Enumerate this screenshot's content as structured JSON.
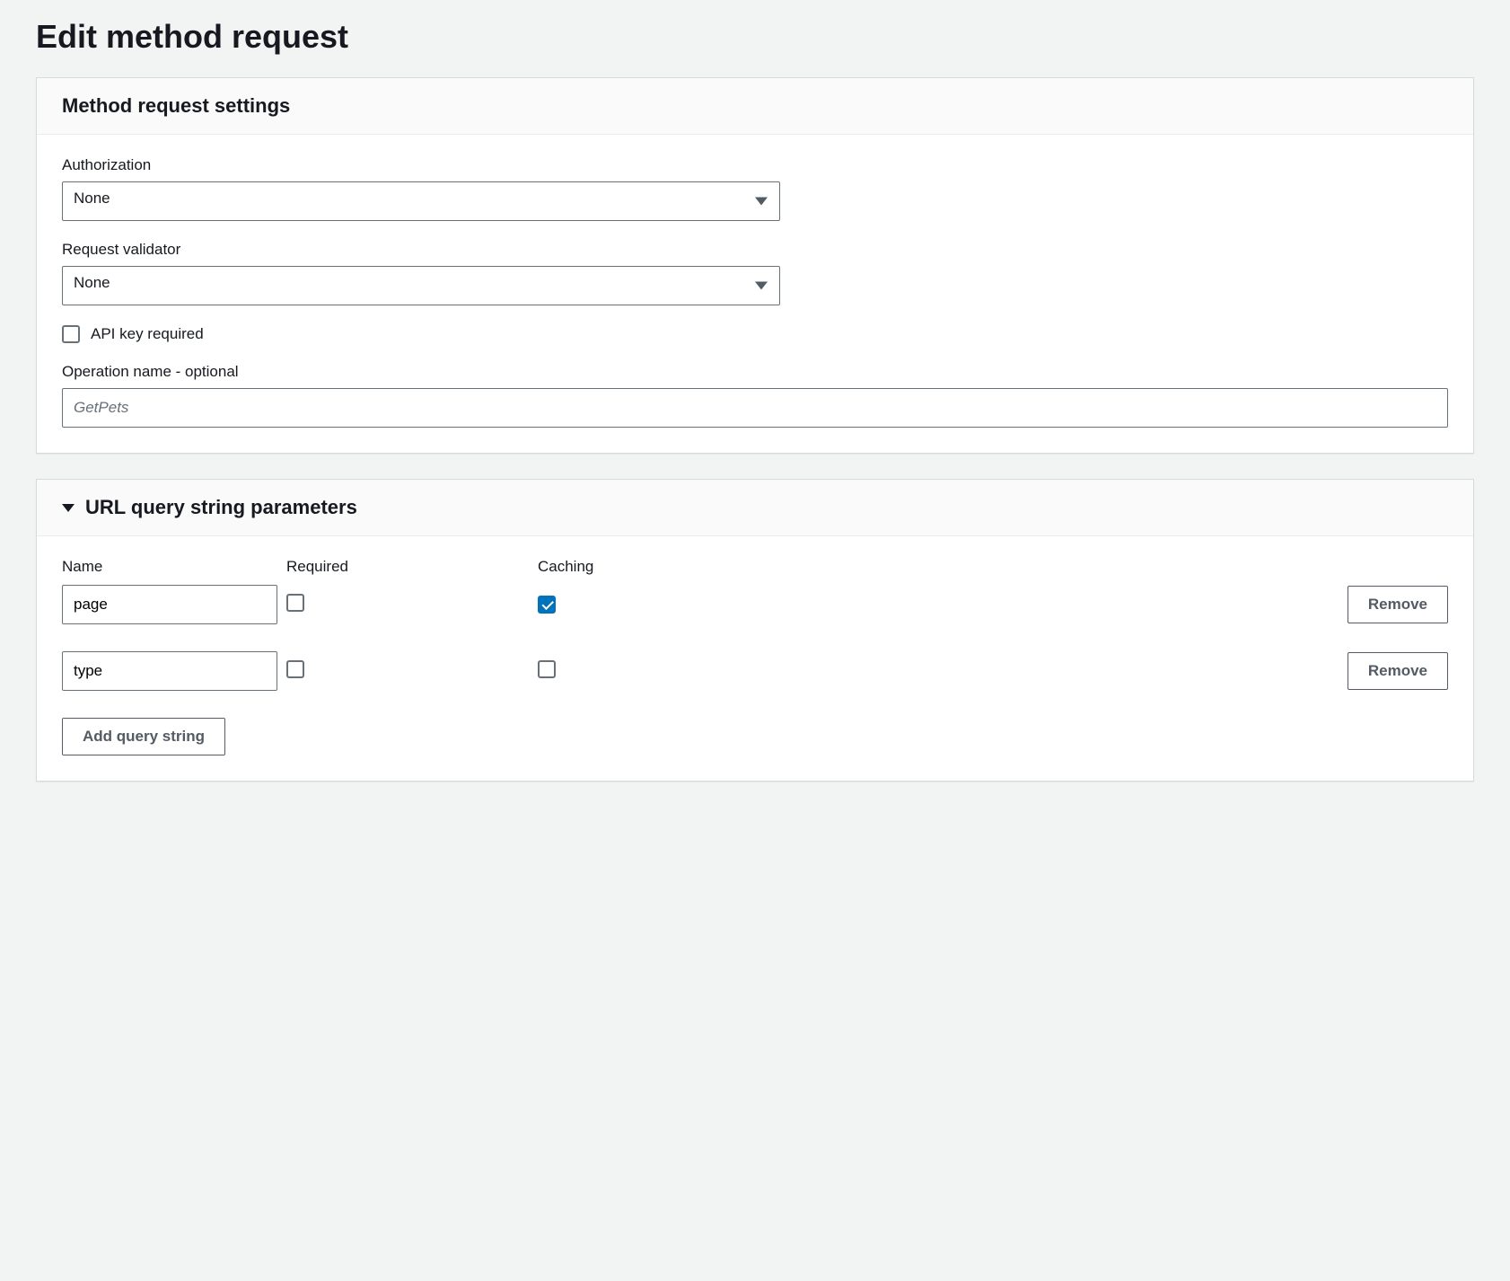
{
  "page": {
    "title": "Edit method request"
  },
  "settings": {
    "section_title": "Method request settings",
    "authorization": {
      "label": "Authorization",
      "value": "None"
    },
    "request_validator": {
      "label": "Request validator",
      "value": "None"
    },
    "api_key_required": {
      "label": "API key required",
      "checked": false
    },
    "operation_name": {
      "label": "Operation name - optional",
      "placeholder": "GetPets",
      "value": ""
    }
  },
  "query_params": {
    "section_title": "URL query string parameters",
    "columns": {
      "name": "Name",
      "required": "Required",
      "caching": "Caching"
    },
    "rows": [
      {
        "name": "page",
        "required": false,
        "caching": true
      },
      {
        "name": "type",
        "required": false,
        "caching": false
      }
    ],
    "remove_label": "Remove",
    "add_label": "Add query string"
  }
}
